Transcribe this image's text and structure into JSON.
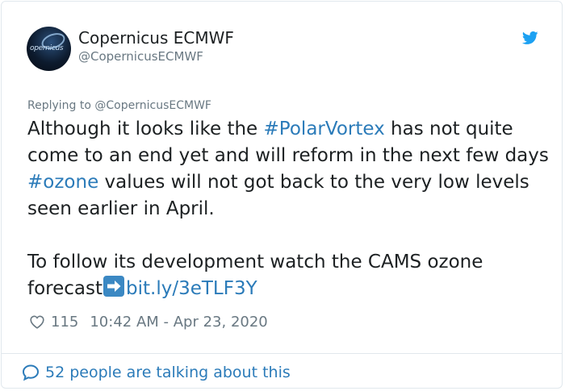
{
  "author": {
    "name": "Copernicus ECMWF",
    "handle": "@CopernicusECMWF",
    "avatar_text": "opernicus"
  },
  "reply": {
    "prefix": "Replying to ",
    "to": "@CopernicusECMWF"
  },
  "tweet": {
    "p1_a": "Although it looks like the ",
    "hashtag_polar": "#PolarVortex",
    "p1_b": " has not quite come to an end yet and will reform in the next few days ",
    "hashtag_ozone": "#ozone",
    "p1_c": " values will not got back to the very low levels seen earlier in April.",
    "p2_a": "To follow its development watch the CAMS ozone forecast",
    "link": "bit.ly/3eTLF3Y"
  },
  "stats": {
    "likes": "115",
    "timestamp": "10:42 AM - Apr 23, 2020"
  },
  "footer": {
    "talking": "52 people are talking about this"
  },
  "colors": {
    "link": "#2b7bb9",
    "twitter_blue": "#1da1f2",
    "muted": "#697882",
    "text": "#1c2022",
    "border": "#e1e8ed"
  },
  "icons": {
    "bird": "twitter-bird-icon",
    "heart": "heart-icon",
    "arrow": "right-arrow-emoji-icon",
    "bubble": "speech-bubble-icon"
  }
}
